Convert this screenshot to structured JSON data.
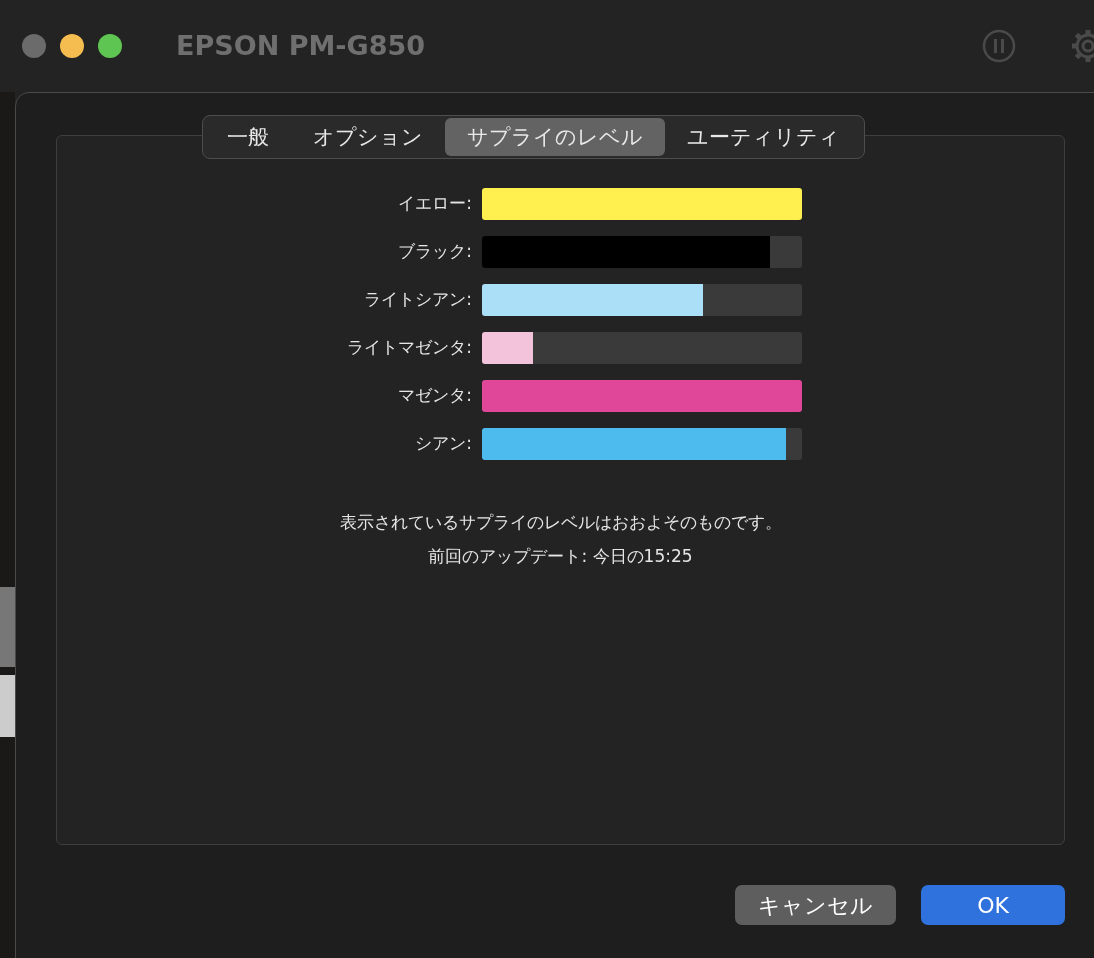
{
  "window": {
    "title": "EPSON PM-G850"
  },
  "tabs": [
    {
      "label": "一般",
      "selected": false
    },
    {
      "label": "オプション",
      "selected": false
    },
    {
      "label": "サプライのレベル",
      "selected": true
    },
    {
      "label": "ユーティリティ",
      "selected": false
    }
  ],
  "supplies": [
    {
      "name": "イエロー:",
      "level": 1.0,
      "color": "#fff04f"
    },
    {
      "name": "ブラック:",
      "level": 0.9,
      "color": "#000000"
    },
    {
      "name": "ライトシアン:",
      "level": 0.69,
      "color": "#abdff8"
    },
    {
      "name": "ライトマゼンタ:",
      "level": 0.16,
      "color": "#f2c3da"
    },
    {
      "name": "マゼンタ:",
      "level": 1.0,
      "color": "#e04799"
    },
    {
      "name": "シアン:",
      "level": 0.95,
      "color": "#4dbbee"
    }
  ],
  "notes": [
    "表示されているサプライのレベルはおおよそのものです。",
    "前回のアップデート: 今日の15:25"
  ],
  "buttons": [
    {
      "label": "キャンセル",
      "kind": "secondary"
    },
    {
      "label": "OK",
      "kind": "primary"
    }
  ]
}
